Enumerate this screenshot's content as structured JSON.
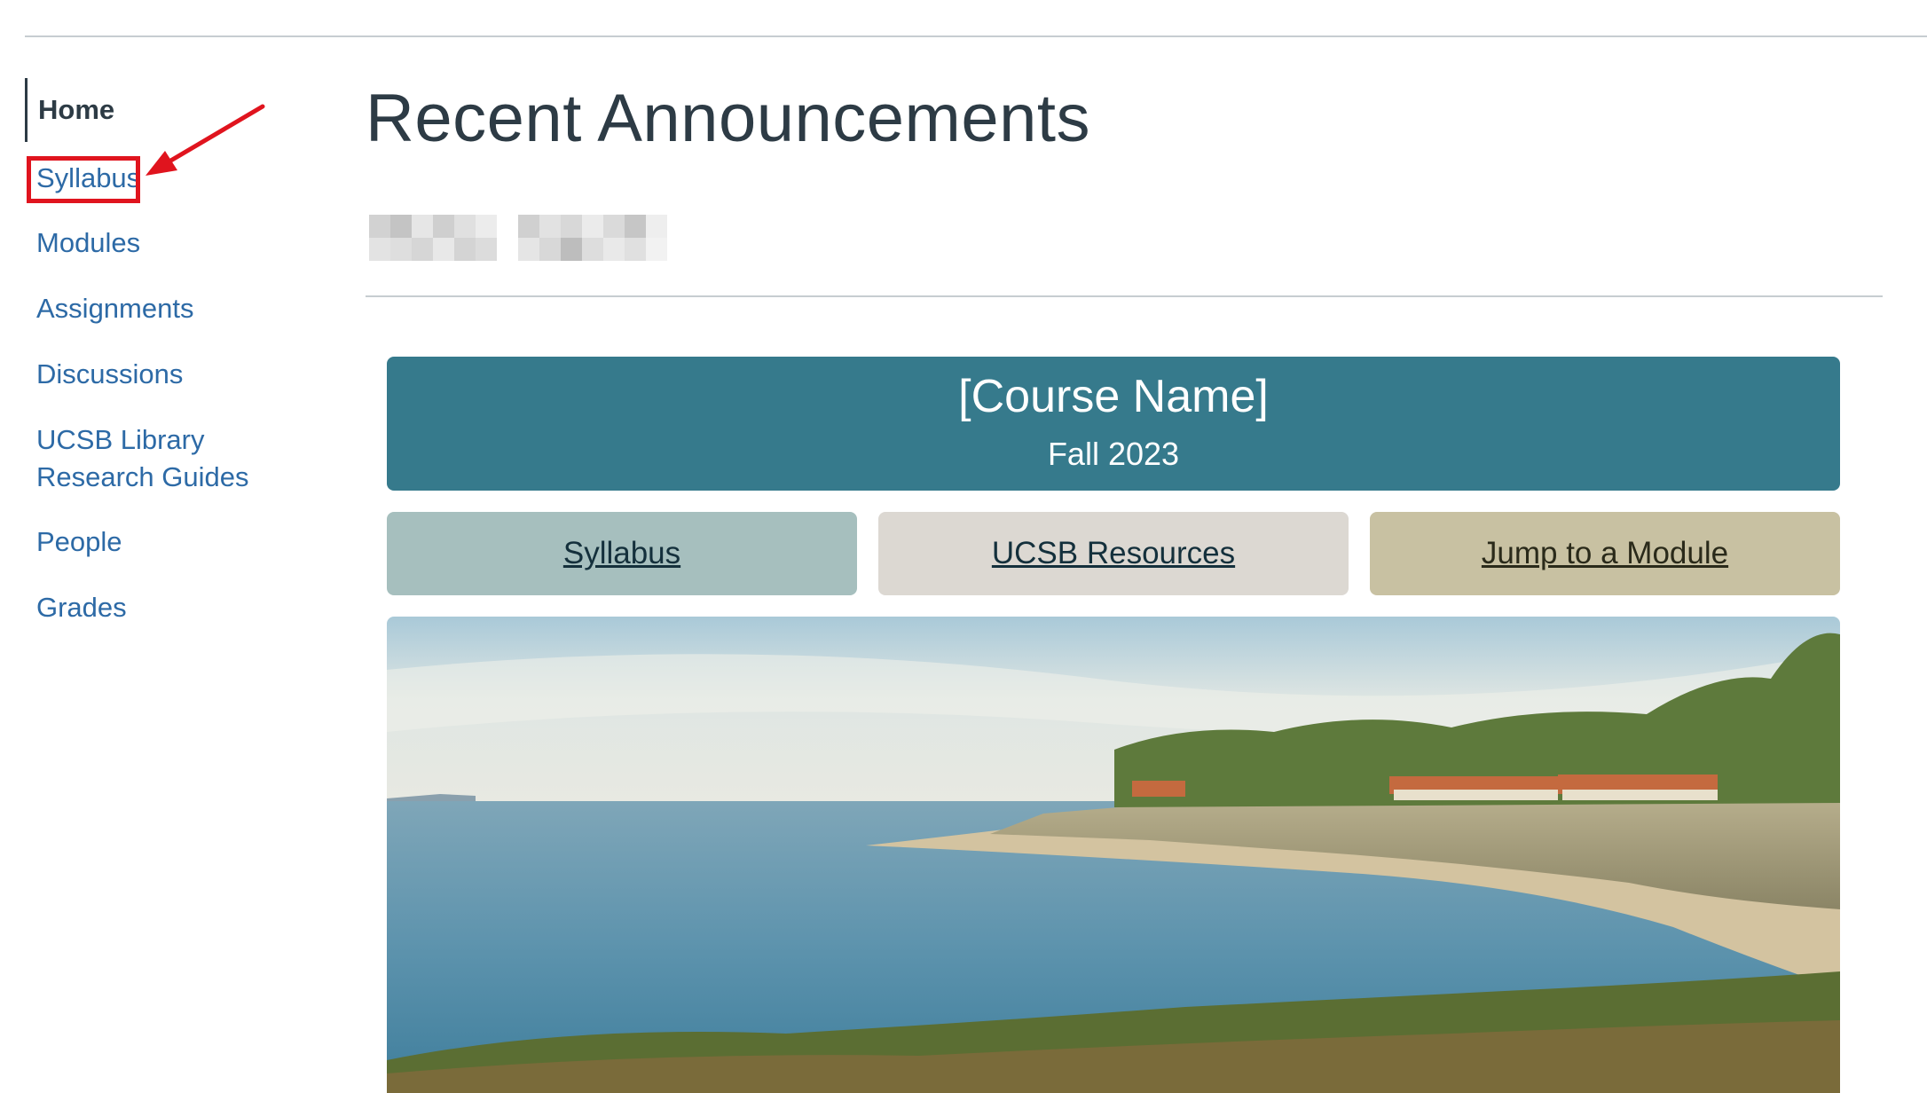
{
  "sidebar": {
    "items": [
      {
        "label": "Home"
      },
      {
        "label": "Syllabus"
      },
      {
        "label": "Modules"
      },
      {
        "label": "Assignments"
      },
      {
        "label": "Discussions"
      },
      {
        "label": "UCSB Library Research Guides"
      },
      {
        "label": "People"
      },
      {
        "label": "Grades"
      }
    ]
  },
  "main": {
    "title": "Recent Announcements",
    "banner": {
      "title": "[Course Name]",
      "subtitle": "Fall 2023"
    },
    "buttons": [
      {
        "label": "Syllabus"
      },
      {
        "label": "UCSB Resources"
      },
      {
        "label": "Jump to a Module"
      }
    ]
  },
  "colors": {
    "link": "#2d6aa6",
    "banner": "#367a8c",
    "btn_syllabus": "#a6bfbe",
    "btn_resources": "#dcd8d2",
    "btn_module": "#c8c1a2",
    "highlight": "#e0141e"
  }
}
